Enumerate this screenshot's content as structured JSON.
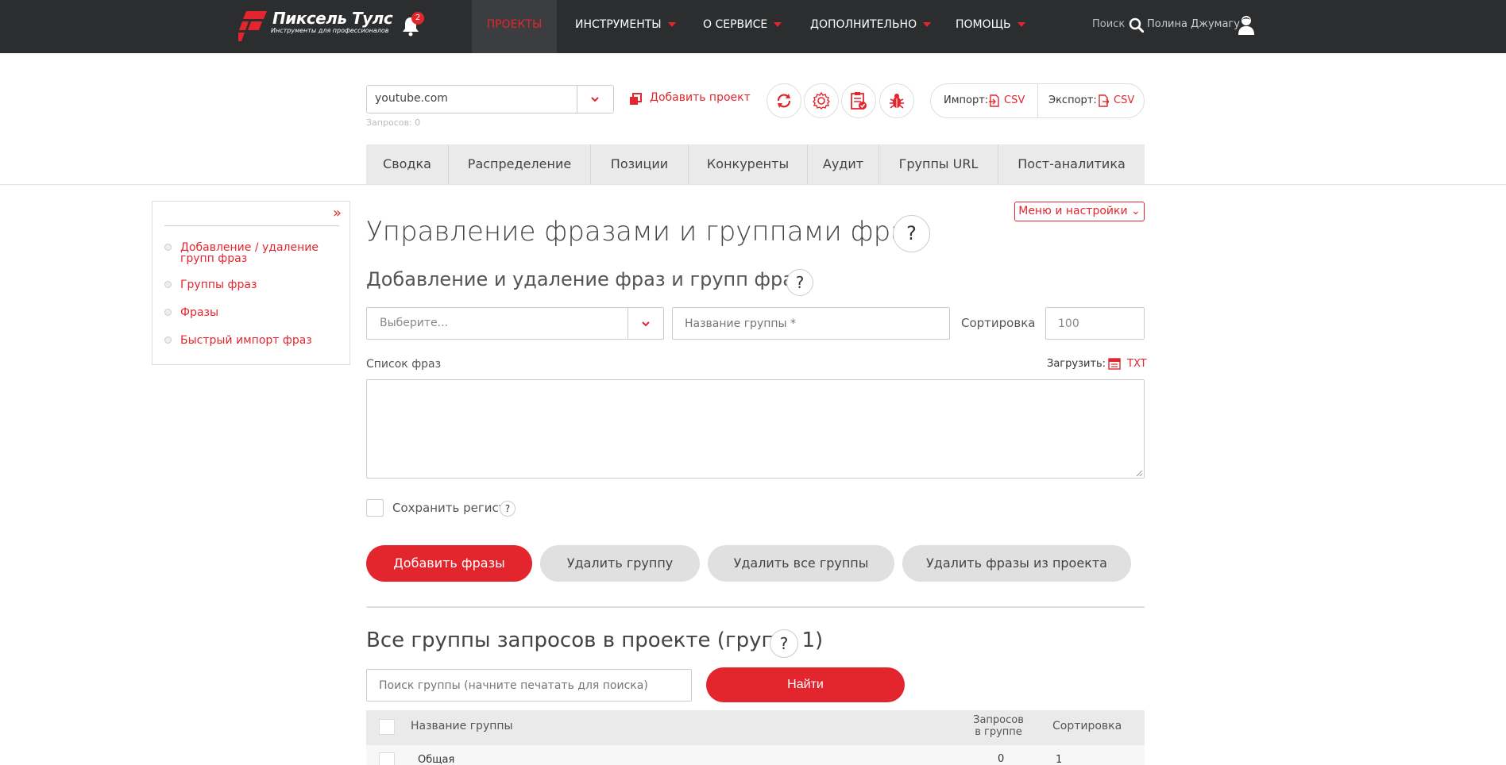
{
  "brand": {
    "title": "Пиксель Тулс",
    "subtitle": "Инструменты для профессионалов",
    "accent": "#e3262e"
  },
  "notifications": {
    "count": "2"
  },
  "nav": {
    "projects": "ПРОЕКТЫ",
    "tools": "ИНСТРУМЕНТЫ",
    "about": "О СЕРВИСЕ",
    "extra": "ДОПОЛНИТЕЛЬНО",
    "help": "ПОМОЩЬ"
  },
  "header": {
    "search_label": "Поиск",
    "user_name": "Полина Джумагу"
  },
  "project": {
    "selected": "youtube.com",
    "requests_label": "Запросов: 0",
    "add_project": "Добавить проект",
    "import_label": "Импорт:",
    "import_format": "CSV",
    "export_label": "Экспорт:",
    "export_format": "CSV"
  },
  "tabs": [
    {
      "label": "Сводка"
    },
    {
      "label": "Распределение"
    },
    {
      "label": "Позиции"
    },
    {
      "label": "Конкуренты"
    },
    {
      "label": "Аудит"
    },
    {
      "label": "Группы URL"
    },
    {
      "label": "Пост-аналитика"
    }
  ],
  "sidebar": {
    "collapse_icon": "»",
    "items": [
      {
        "label": "Добавление / удаление групп фраз"
      },
      {
        "label": "Группы фраз"
      },
      {
        "label": "Фразы"
      },
      {
        "label": "Быстрый импорт фраз"
      }
    ]
  },
  "main": {
    "menu_settings": "Меню и настройки",
    "title": "Управление фразами и группами фраз",
    "help_glyph": "?",
    "subtitle": "Добавление и удаление фраз и групп фраз",
    "group_select_placeholder": "Выберите...",
    "group_name_placeholder": "Название группы *",
    "sort_label": "Сортировка",
    "sort_value": "100",
    "phrase_list_label": "Список фраз",
    "load_label": "Загрузить:",
    "load_format": "TXT",
    "keep_case_label": "Сохранить регистр",
    "buttons": {
      "add": "Добавить фразы",
      "delete_group": "Удалить группу",
      "delete_all": "Удалить все группы",
      "delete_phrases": "Удалить фразы из проекта"
    },
    "groups_title": "Все группы запросов в проекте (групп: 1)",
    "group_search_placeholder": "Поиск группы (начните печатать для поиска)",
    "find_button": "Найти",
    "table": {
      "headers": {
        "name": "Название группы",
        "count_line1": "Запросов",
        "count_line2": "в группе",
        "sort": "Сортировка"
      },
      "rows": [
        {
          "name": "Общая",
          "count": "0",
          "sort": "1"
        }
      ]
    }
  }
}
